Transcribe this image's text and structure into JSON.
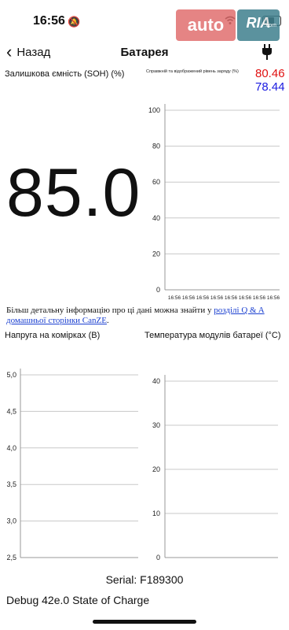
{
  "status_bar": {
    "time": "16:56"
  },
  "watermark": {
    "auto": "auto",
    "ria": "RIA",
    "ria_domain": ".com"
  },
  "nav": {
    "back_label": "Назад",
    "title": "Батарея"
  },
  "soh": {
    "label": "Залишкова ємність (SOH) (%)",
    "value": "85.0"
  },
  "charge_chart": {
    "title": "Справжній та відображений рівень заряду (%)",
    "value_red": "80.46",
    "value_blue": "78.44",
    "colors": {
      "red": "#e01010",
      "blue": "#1a1ae0"
    }
  },
  "info": {
    "text": "Більш детальну інформацію про ці дані можна знайти у ",
    "link": "розділі Q & A домашньої сторінки CanZE",
    "suffix": "."
  },
  "cell_voltage": {
    "label": "Напруга на комірках (В)"
  },
  "module_temp": {
    "label": "Температура модулів батареї (°C)"
  },
  "serial": "Serial: F189300",
  "debug": "Debug 42e.0 State of Charge",
  "chart_data": [
    {
      "type": "line",
      "title": "Справжній та відображений рівень заряду (%)",
      "ylim": [
        0,
        100
      ],
      "yticks": [
        "0",
        "20",
        "40",
        "60",
        "80",
        "100"
      ],
      "xticks": [
        "16:56",
        "16:56",
        "16:56",
        "16:56",
        "16:56",
        "16:56",
        "16:56",
        "16:56"
      ],
      "grid": true,
      "series": []
    },
    {
      "type": "line",
      "title": "Напруга на комірках (В)",
      "ylim": [
        2.5,
        5.0
      ],
      "yticks": [
        "2,5",
        "3,0",
        "3,5",
        "4,0",
        "4,5",
        "5,0"
      ],
      "grid": true,
      "series": []
    },
    {
      "type": "line",
      "title": "Температура модулів батареї (°C)",
      "ylim": [
        0,
        40
      ],
      "yticks": [
        "0",
        "10",
        "20",
        "30",
        "40"
      ],
      "grid": true,
      "series": []
    }
  ]
}
